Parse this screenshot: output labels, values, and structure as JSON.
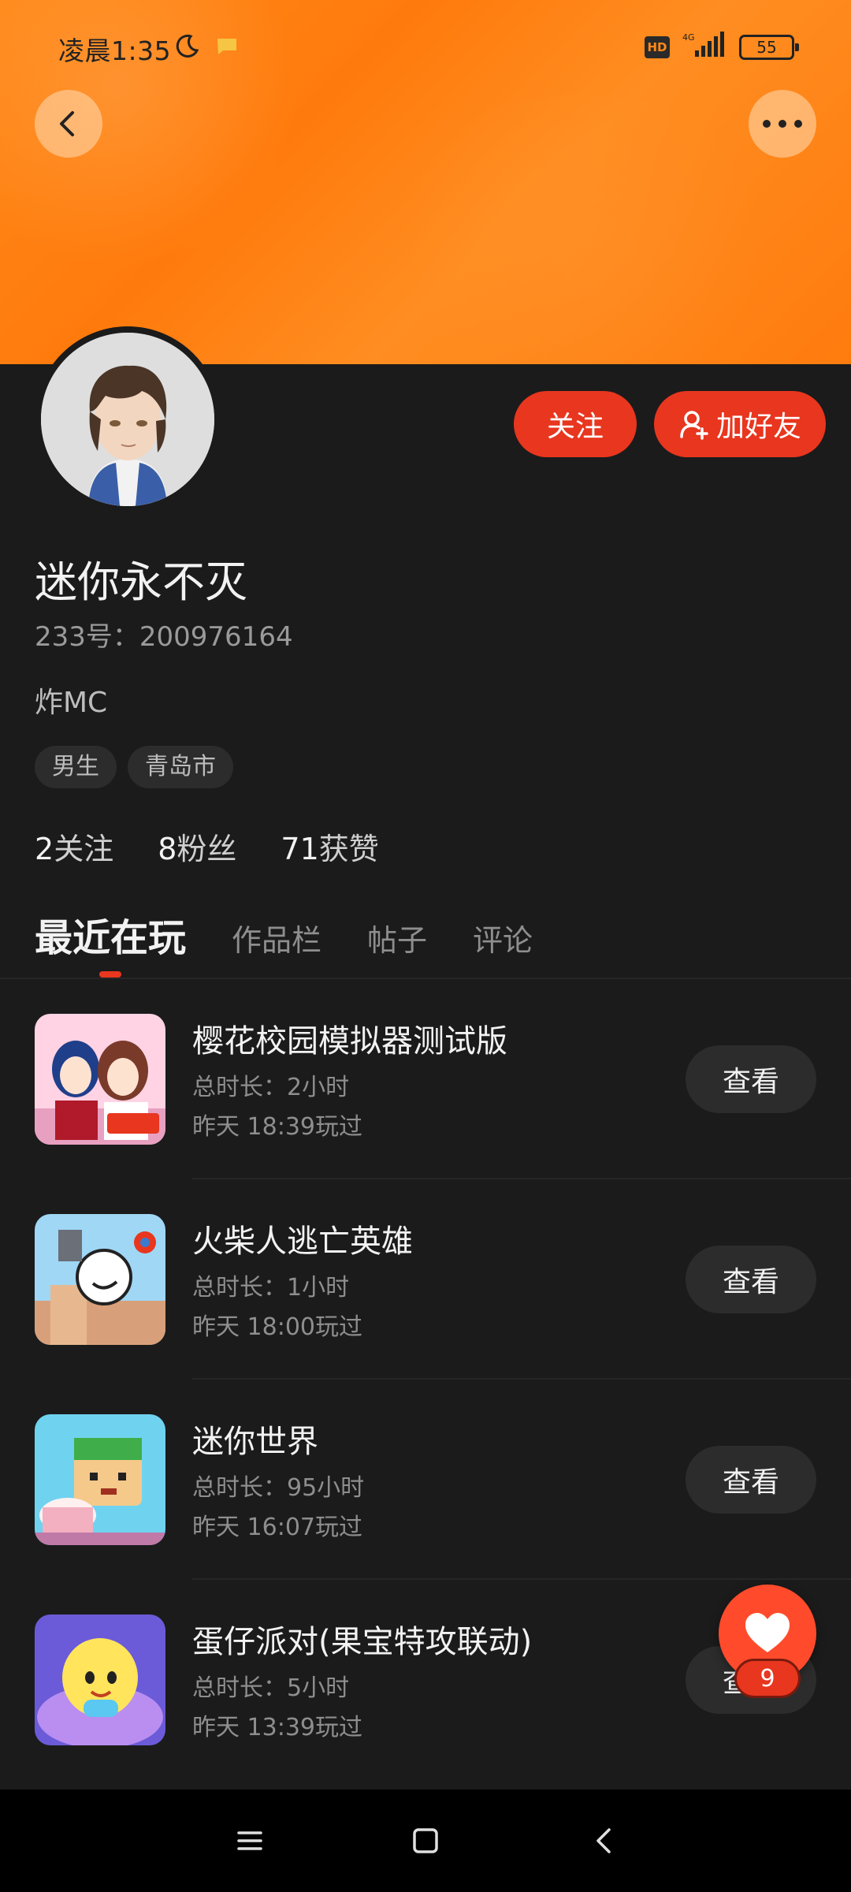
{
  "status_bar": {
    "time": "凌晨1:35",
    "network": "4G",
    "battery": "55",
    "hd_label": "HD"
  },
  "header": {
    "back_icon": "chevron-left-icon",
    "more_icon": "more-dots-icon",
    "banner_color": "#ff8a1a"
  },
  "profile": {
    "username": "迷你永不灭",
    "user_id": "233号：200976164",
    "bio": "炸MC",
    "tags": [
      "男生",
      "青岛市"
    ],
    "follow_label": "关注",
    "add_friend_label": "加好友",
    "stats": [
      {
        "num": "2",
        "label": "关注"
      },
      {
        "num": "8",
        "label": "粉丝"
      },
      {
        "num": "71",
        "label": "获赞"
      }
    ]
  },
  "tabs": [
    {
      "label": "最近在玩",
      "active": true
    },
    {
      "label": "作品栏",
      "active": false
    },
    {
      "label": "帖子",
      "active": false
    },
    {
      "label": "评论",
      "active": false
    }
  ],
  "games": [
    {
      "title": "樱花校园模拟器测试版",
      "duration": "总时长：2小时",
      "last_played": "昨天 18:39玩过",
      "button": "查看"
    },
    {
      "title": "火柴人逃亡英雄",
      "duration": "总时长：1小时",
      "last_played": "昨天 18:00玩过",
      "button": "查看"
    },
    {
      "title": "迷你世界",
      "duration": "总时长：95小时",
      "last_played": "昨天 16:07玩过",
      "button": "查看"
    },
    {
      "title": "蛋仔派对(果宝特攻联动)",
      "duration": "总时长：5小时",
      "last_played": "昨天 13:39玩过",
      "button": "查看"
    }
  ],
  "like_fab": {
    "count": "9",
    "accent": "#e8361f"
  },
  "nav": {
    "menu_icon": "menu-icon",
    "home_icon": "home-square-icon",
    "back_icon": "back-triangle-icon"
  }
}
